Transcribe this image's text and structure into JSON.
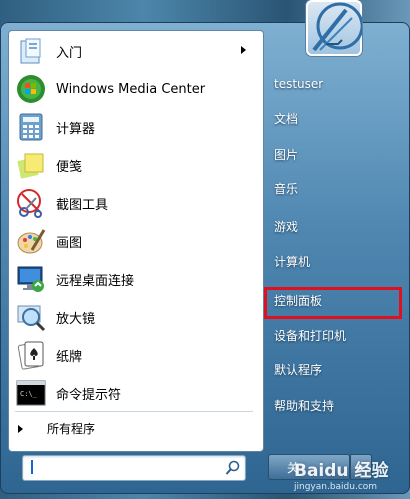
{
  "programs": [
    {
      "label": "入门",
      "icon": "getting-started-icon",
      "has_submenu": true
    },
    {
      "label": "Windows Media Center",
      "icon": "windows-media-center-icon"
    },
    {
      "label": "计算器",
      "icon": "calculator-icon"
    },
    {
      "label": "便笺",
      "icon": "sticky-notes-icon"
    },
    {
      "label": "截图工具",
      "icon": "snipping-tool-icon"
    },
    {
      "label": "画图",
      "icon": "paint-icon"
    },
    {
      "label": "远程桌面连接",
      "icon": "remote-desktop-icon"
    },
    {
      "label": "放大镜",
      "icon": "magnifier-icon"
    },
    {
      "label": "纸牌",
      "icon": "solitaire-icon"
    },
    {
      "label": "命令提示符",
      "icon": "command-prompt-icon"
    }
  ],
  "all_programs_label": "所有程序",
  "right_items": [
    {
      "label": "testuser"
    },
    {
      "label": "文档"
    },
    {
      "label": "图片"
    },
    {
      "label": "音乐"
    },
    {
      "label": "游戏"
    },
    {
      "label": "计算机"
    },
    {
      "label": "控制面板",
      "highlighted": true
    },
    {
      "label": "设备和打印机"
    },
    {
      "label": "默认程序"
    },
    {
      "label": "帮助和支持"
    }
  ],
  "shutdown_label": "关",
  "watermark": {
    "brand": "Baidu 经验",
    "url": "jingyan.baidu.com"
  },
  "colors": {
    "highlight": "#e0101e",
    "pane_blue": "#4e86b0"
  }
}
